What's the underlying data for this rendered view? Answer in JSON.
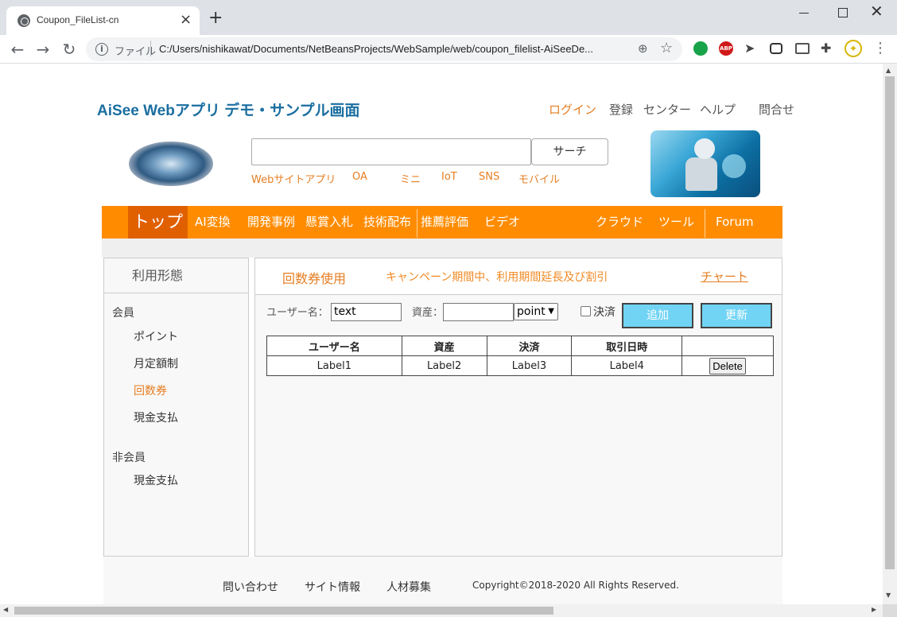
{
  "browser": {
    "tab_title": "Coupon_FileList-cn",
    "url_scheme": "ファイル",
    "url": "C:/Users/nishikawat/Documents/NetBeansProjects/WebSample/web/coupon_filelist-AiSeeDe..."
  },
  "header": {
    "site_title": "AiSee Webアプリ デモ・サンプル画面",
    "links": [
      "ログイン",
      "登録",
      "センター",
      "ヘルプ",
      "問合せ"
    ],
    "active_link": "ログイン"
  },
  "search": {
    "value": "",
    "button_label": "サーチ",
    "categories": [
      "Webサイトアプリ",
      "OA",
      "ミニ",
      "IoT",
      "SNS",
      "モバイル"
    ]
  },
  "navbar": {
    "items": [
      "トップ",
      "AI変換",
      "開発事例",
      "懸賞入札",
      "技術配布",
      "推薦評価",
      "ビデオ",
      "クラウド",
      "ツール",
      "Forum"
    ],
    "active": "トップ"
  },
  "sidebar": {
    "title": "利用形態",
    "group1": "会員",
    "group1_items": [
      "ポイント",
      "月定額制",
      "回数券",
      "現金支払"
    ],
    "group2": "非会員",
    "group2_items": [
      "現金支払"
    ],
    "active_item": "回数券"
  },
  "main": {
    "title": "回数券使用",
    "subtitle": "キャンペーン期間中、利用期間延長及び割引",
    "chart_link": "チャート",
    "form": {
      "username_label": "ユーザー名：",
      "username_value": "text",
      "asset_label": "資産：",
      "asset_value": "",
      "unit_value": "point",
      "settled_label": "決済",
      "add_button": "追加",
      "update_button": "更新"
    },
    "table": {
      "headers": [
        "ユーザー名",
        "資産",
        "決済",
        "取引日時",
        ""
      ],
      "rows": [
        [
          "Label1",
          "Label2",
          "Label3",
          "Label4"
        ]
      ],
      "delete_label": "Delete"
    }
  },
  "footer": {
    "links": [
      "問い合わせ",
      "サイト情報",
      "人材募集"
    ],
    "copyright": "Copyright©2018-2020 All Rights Reserved."
  },
  "colors": {
    "accent": "#ff8c00",
    "nav_active": "#e06000",
    "title_blue": "#1a6ea0",
    "button_blue": "#71d4f5",
    "link_orange": "#e67e22"
  }
}
